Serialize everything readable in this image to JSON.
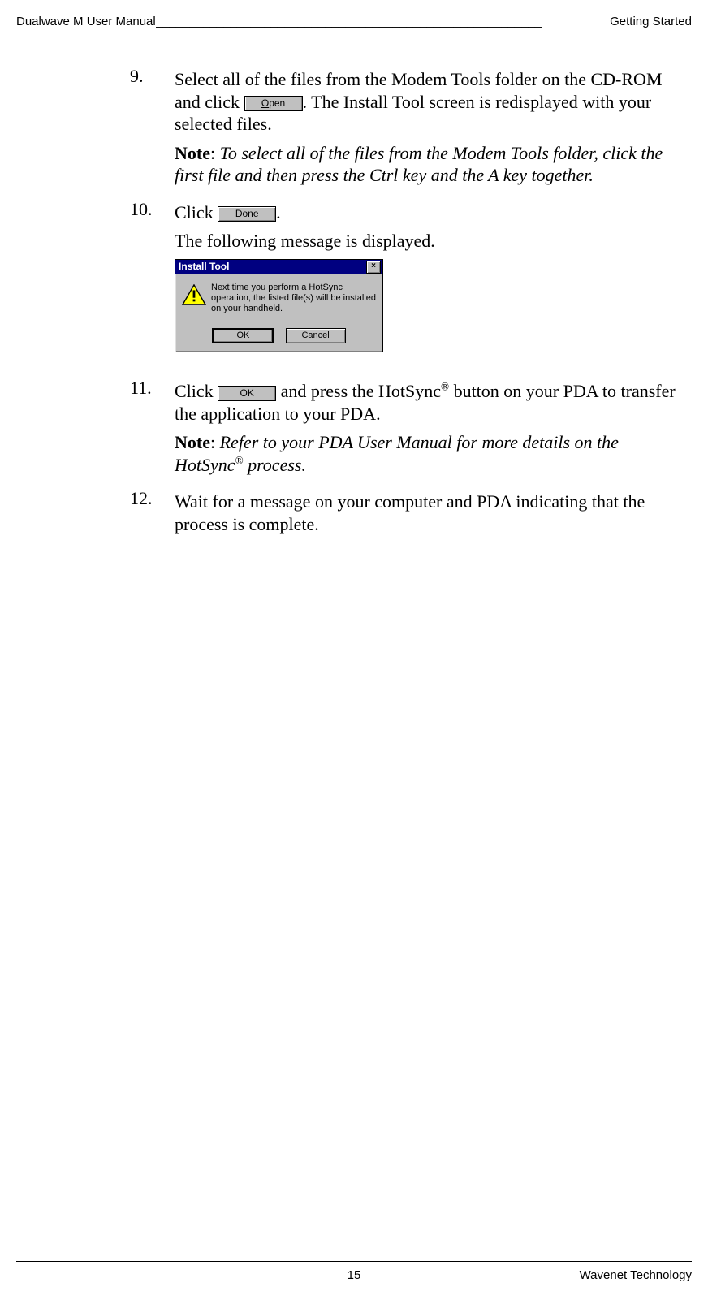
{
  "header": {
    "left": "Dualwave M User Manual",
    "fill": " _________________________________________________________",
    "right": " Getting Started"
  },
  "steps": {
    "s9": {
      "num": "9.",
      "text_a": "Select all of the files from the Modem Tools folder on the CD-ROM and click ",
      "btn_open_u": "O",
      "btn_open_rest": "pen",
      "text_b": ". The Install Tool screen is redisplayed with your selected files.",
      "note_label": "Note",
      "note_colon": ": ",
      "note_text": "To select all of the files from the Modem Tools folder, click the first file and then press the Ctrl key and the A key together."
    },
    "s10": {
      "num": "10.",
      "text_a": "Click ",
      "btn_done_u": "D",
      "btn_done_rest": "one",
      "text_b": ".",
      "para1": "The following message is displayed."
    },
    "s11": {
      "num": "11.",
      "text_a": "Click ",
      "btn_ok": "OK",
      "text_b": " and press the HotSync",
      "reg": "®",
      "text_c": " button on your PDA to transfer the application to your PDA.",
      "note_label": "Note",
      "note_colon": ": ",
      "note_text_a": "Refer to your PDA User Manual for more details on the HotSync",
      "note_reg": "®",
      "note_text_b": " process."
    },
    "s12": {
      "num": "12.",
      "text": "Wait for a message on your computer and PDA indicating that the process is complete."
    }
  },
  "dialog": {
    "title": "Install Tool",
    "close": "×",
    "message": "Next time you perform a HotSync operation, the listed file(s) will be installed on your handheld.",
    "btn_ok": "OK",
    "btn_cancel": "Cancel"
  },
  "footer": {
    "page": "15",
    "right": "Wavenet Technology"
  }
}
